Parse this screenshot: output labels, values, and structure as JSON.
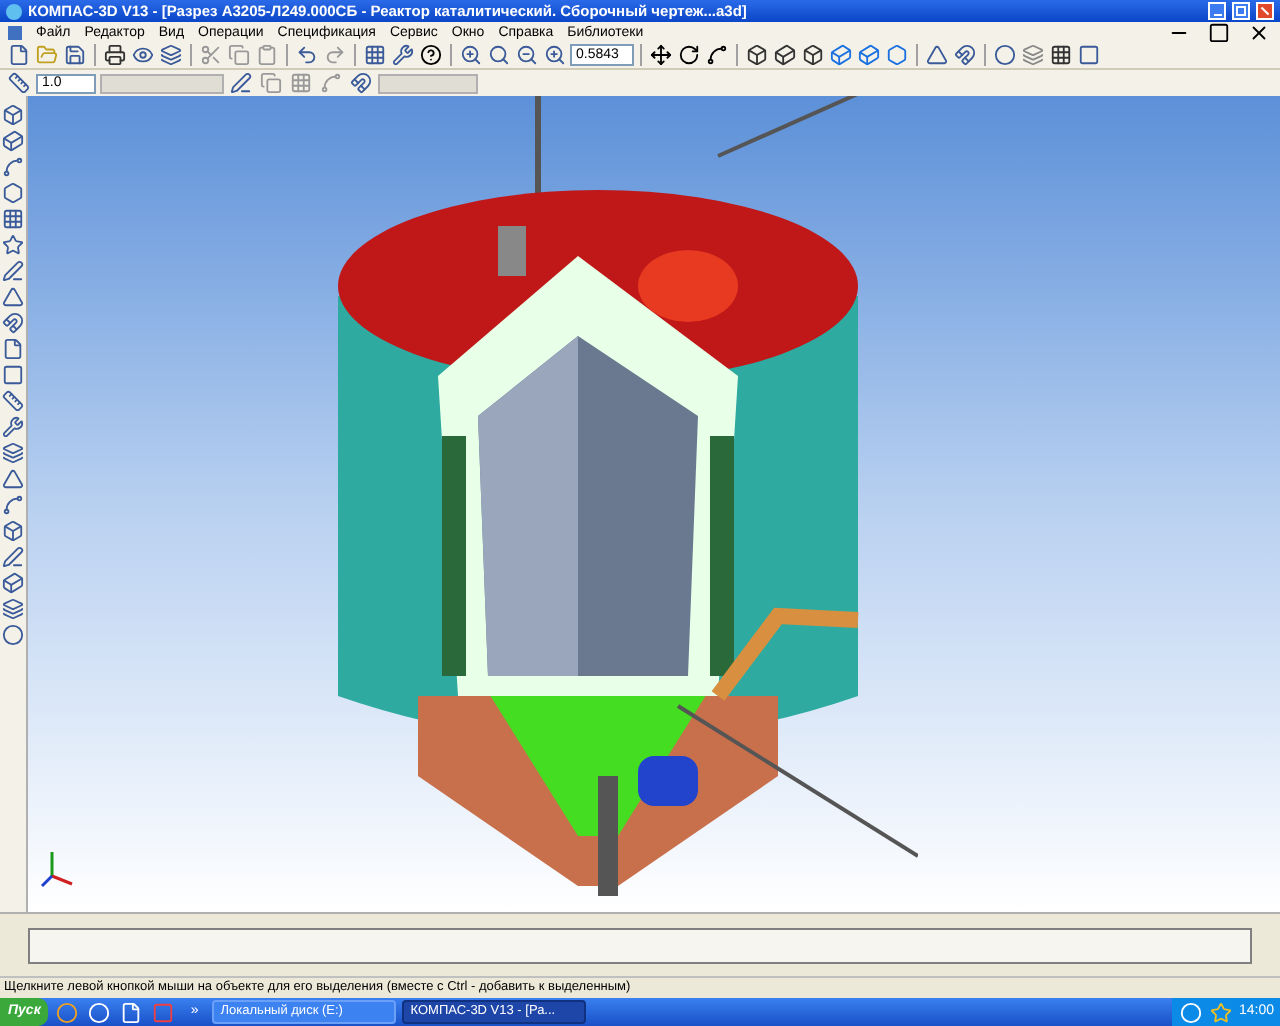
{
  "window": {
    "title": "КОМПАС-3D V13 - [Разрез А3205-Л249.000СБ - Реактор каталитический. Сборочный чертеж...a3d]"
  },
  "menu": [
    "Файл",
    "Редактор",
    "Вид",
    "Операции",
    "Спецификация",
    "Сервис",
    "Окно",
    "Справка",
    "Библиотеки"
  ],
  "toolbar": {
    "zoom_value": "0.5843",
    "step_value": "1.0"
  },
  "status_bar": "Щелкните левой кнопкой мыши на объекте для его выделения (вместе с Ctrl - добавить к выделенным)",
  "taskbar": {
    "start": "Пуск",
    "more": "»",
    "tasks": [
      {
        "label": "Локальный диск (E:)",
        "selected": false
      },
      {
        "label": "КОМПАС-3D V13 - [Ра...",
        "selected": true
      }
    ],
    "clock": "14:00"
  }
}
